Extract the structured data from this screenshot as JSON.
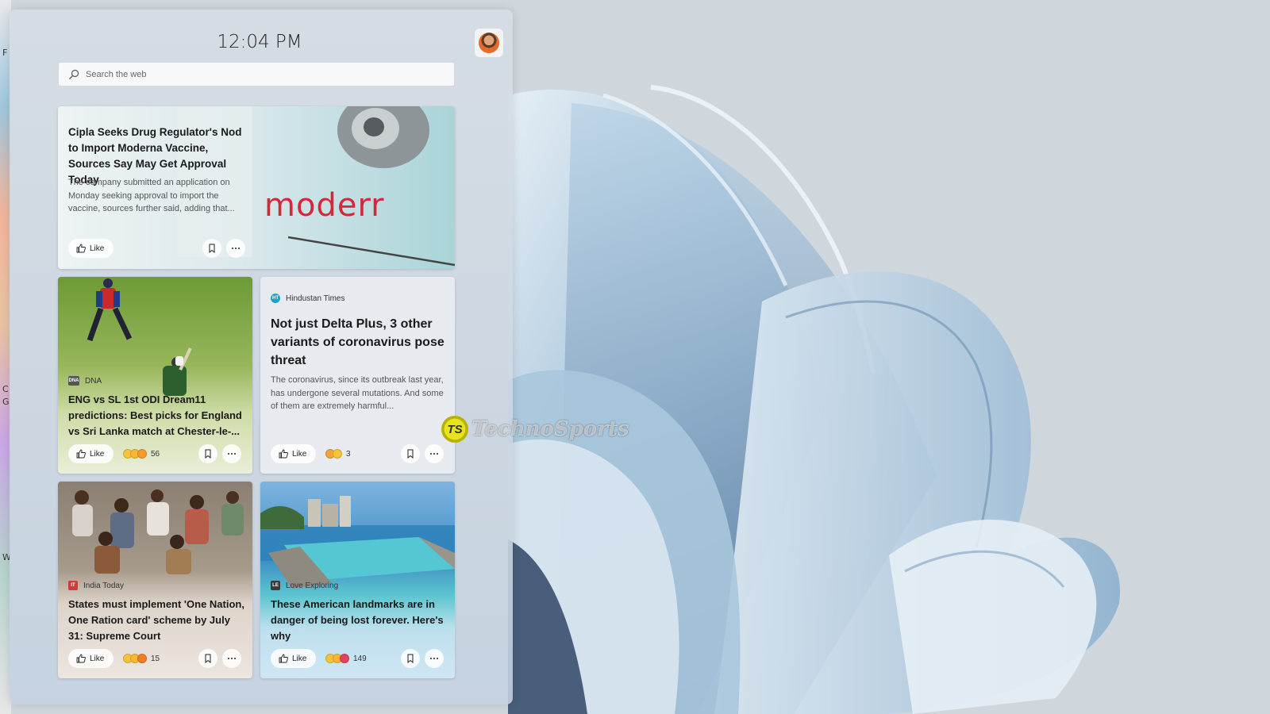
{
  "clock": {
    "time": "12:04 PM"
  },
  "search": {
    "placeholder": "Search the web"
  },
  "colors": {
    "panel": "#cdd6df",
    "card_light": "#e9edf1",
    "cricket_card": "#c8d7a7",
    "landmark_card": "#b9d9ef"
  },
  "cards": [
    {
      "title": "Cipla Seeks Drug Regulator's Nod to Import Moderna Vaccine, Sources Say May Get Approval Today",
      "description": "The company submitted an application on Monday seeking approval to import the vaccine, sources further said, adding that...",
      "image_text": "moderr",
      "like_label": "Like"
    },
    {
      "source": "DNA",
      "source_logo": "DNA",
      "title": "ENG vs SL 1st ODI Dream11 predictions: Best picks for England vs Sri Lanka match at Chester-le-...",
      "like_label": "Like",
      "reaction_count": "56"
    },
    {
      "source": "Hindustan Times",
      "source_logo": "HT",
      "title": "Not just Delta Plus, 3 other variants of coronavirus pose threat",
      "description": "The coronavirus, since its outbreak last year, has undergone several mutations. And some of them are extremely harmful...",
      "like_label": "Like",
      "reaction_count": "3"
    },
    {
      "source": "India Today",
      "source_logo": "IT",
      "title": "States must implement 'One Nation, One Ration card' scheme by July 31: Supreme Court",
      "like_label": "Like",
      "reaction_count": "15"
    },
    {
      "source": "Love Exploring",
      "source_logo": "LE",
      "title": "These American landmarks are in danger of being lost forever. Here's why",
      "like_label": "Like",
      "reaction_count": "149"
    }
  ],
  "watermark": {
    "logo": "TS",
    "text": "TechnoSports"
  }
}
